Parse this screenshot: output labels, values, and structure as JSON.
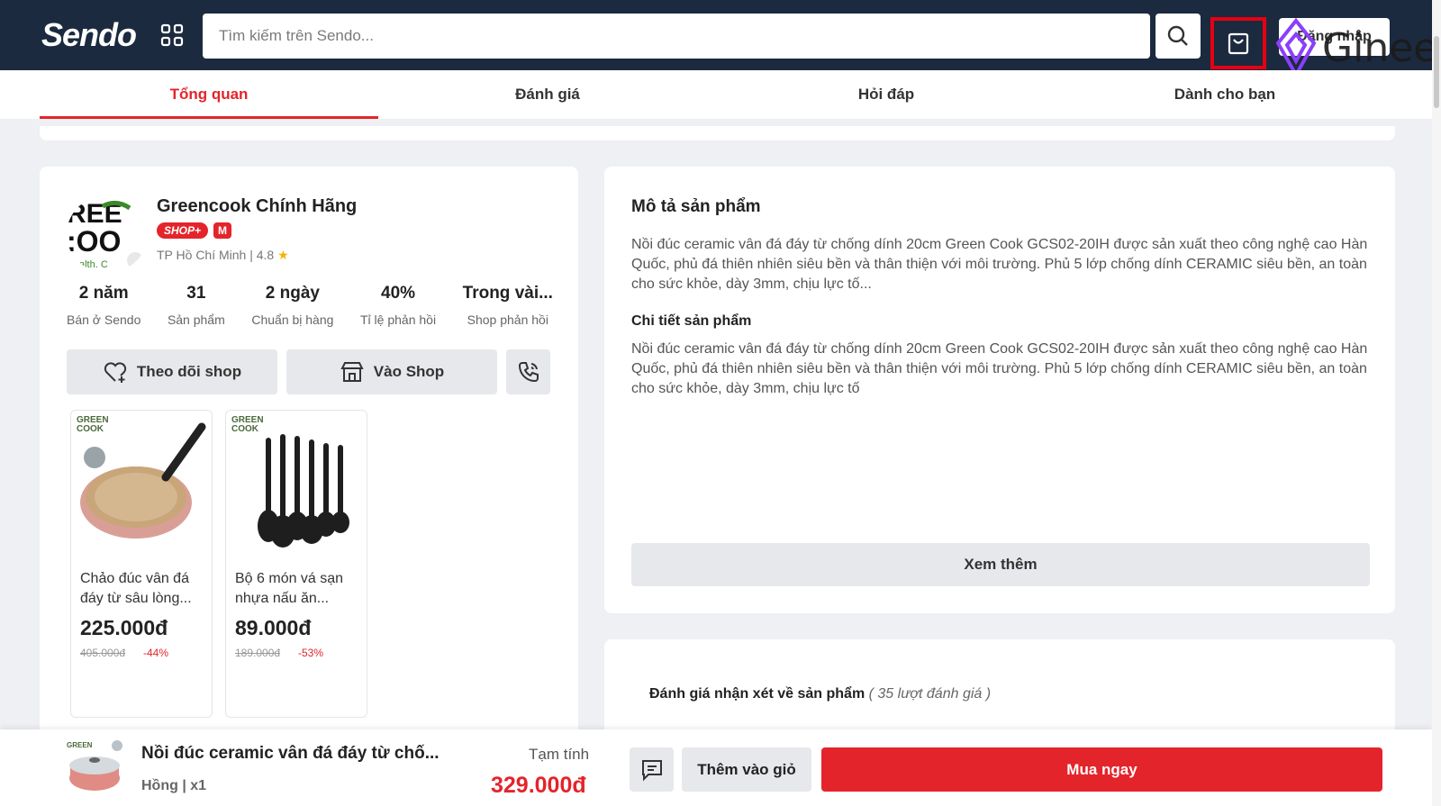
{
  "header": {
    "logo": "Sendo",
    "search_placeholder": "Tìm kiếm trên Sendo...",
    "login_label": "Đăng nhập",
    "watermark": "Ginee"
  },
  "tabs": [
    {
      "label": "Tổng quan",
      "active": true
    },
    {
      "label": "Đánh giá",
      "active": false
    },
    {
      "label": "Hỏi đáp",
      "active": false
    },
    {
      "label": "Dành cho bạn",
      "active": false
    }
  ],
  "shop": {
    "name": "Greencook Chính Hãng",
    "badge": "SHOP+",
    "mall_badge": "M",
    "location": "TP Hồ Chí Minh | 4.8",
    "star": "★",
    "stats": [
      {
        "value": "2 năm",
        "label": "Bán ở Sendo"
      },
      {
        "value": "31",
        "label": "Sản phẩm"
      },
      {
        "value": "2 ngày",
        "label": "Chuẩn bị hàng"
      },
      {
        "value": "40%",
        "label": "Tỉ lệ phản hồi"
      },
      {
        "value": "Trong vài...",
        "label": "Shop phản hồi"
      }
    ],
    "follow_label": "Theo dõi shop",
    "visit_label": "Vào Shop",
    "products": [
      {
        "name": "Chảo đúc vân đá đáy từ sâu lòng...",
        "price": "225.000đ",
        "old_price": "405.000đ",
        "discount": "-44%"
      },
      {
        "name": "Bộ 6 món vá sạn nhựa nấu ăn...",
        "price": "89.000đ",
        "old_price": "189.000đ",
        "discount": "-53%"
      }
    ]
  },
  "description": {
    "title": "Mô tả sản phẩm",
    "text": "Nồi đúc ceramic vân đá đáy từ chống dính 20cm Green Cook GCS02-20IH được sản xuất theo công nghệ cao Hàn Quốc, phủ đá thiên nhiên siêu bền và thân thiện với môi trường. Phủ 5 lớp chống dính CERAMIC siêu bền, an toàn cho sức khỏe, dày 3mm, chịu lực tố...",
    "detail_title": "Chi tiết sản phẩm",
    "detail_text": "Nồi đúc ceramic vân đá đáy từ chống dính 20cm Green Cook GCS02-20IH được sản xuất theo công nghệ cao Hàn Quốc, phủ đá thiên nhiên siêu bền và thân thiện với môi trường. Phủ 5 lớp chống dính CERAMIC siêu bền, an toàn cho sức khỏe, dày 3mm, chịu lực tố",
    "more_label": "Xem thêm"
  },
  "reviews": {
    "title": "Đánh giá nhận xét về sản phẩm",
    "count": "( 35 lượt đánh giá )"
  },
  "bottom": {
    "product_name": "Nồi đúc ceramic vân đá đáy từ chố...",
    "variant": "Hồng | x1",
    "subtotal_label": "Tạm tính",
    "subtotal": "329.000đ",
    "add_to_cart": "Thêm vào giỏ",
    "buy_now": "Mua ngay"
  },
  "colors": {
    "header_bg": "#1b2a3f",
    "accent": "#e4242b",
    "highlight_box": "#e60012",
    "watermark": "#8a3ffc"
  }
}
